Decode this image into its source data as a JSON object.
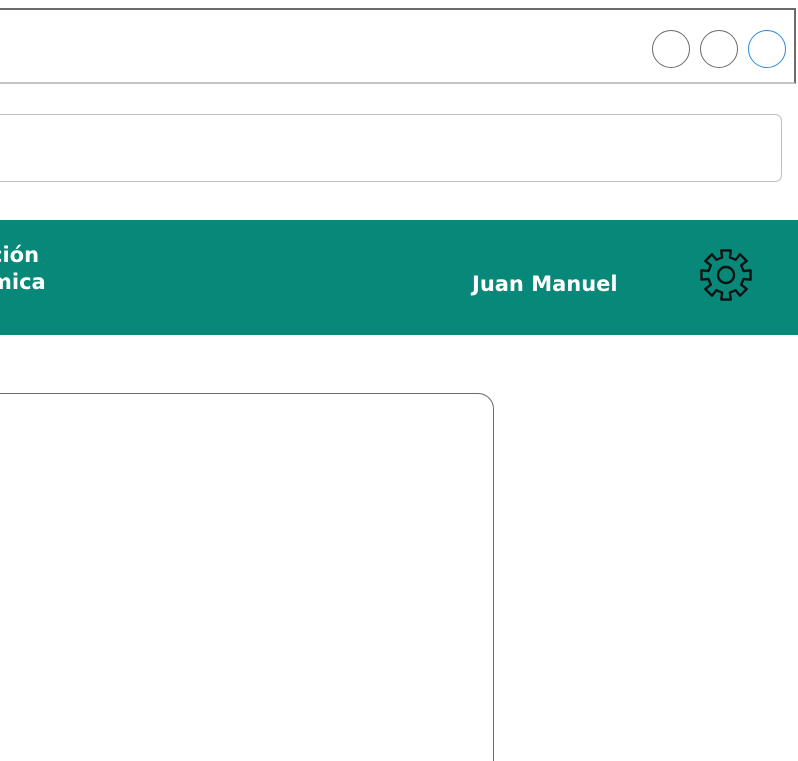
{
  "window": {
    "controls": [
      "minimize",
      "maximize",
      "close"
    ]
  },
  "address_bar": {
    "value": "",
    "placeholder": ""
  },
  "header": {
    "brand_line1": "ción",
    "brand_line2": "mica",
    "user_name": "Juan Manuel",
    "background_color": "#078879",
    "settings_icon": "gear-icon"
  },
  "content": {
    "card_text": ""
  }
}
